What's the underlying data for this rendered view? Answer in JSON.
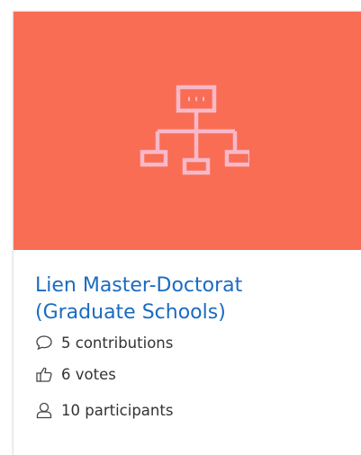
{
  "card": {
    "title": "Lien Master-Doctorat (Graduate Schools)",
    "image_icon": "sitemap-icon",
    "image_background": "#f96d55",
    "icon_color": "#f7b8c9",
    "title_color": "#1a6bc1",
    "stats": [
      {
        "icon": "comment-icon",
        "label": "5 contributions"
      },
      {
        "icon": "thumbs-up-icon",
        "label": "6 votes"
      },
      {
        "icon": "user-icon",
        "label": "10 participants"
      }
    ]
  }
}
